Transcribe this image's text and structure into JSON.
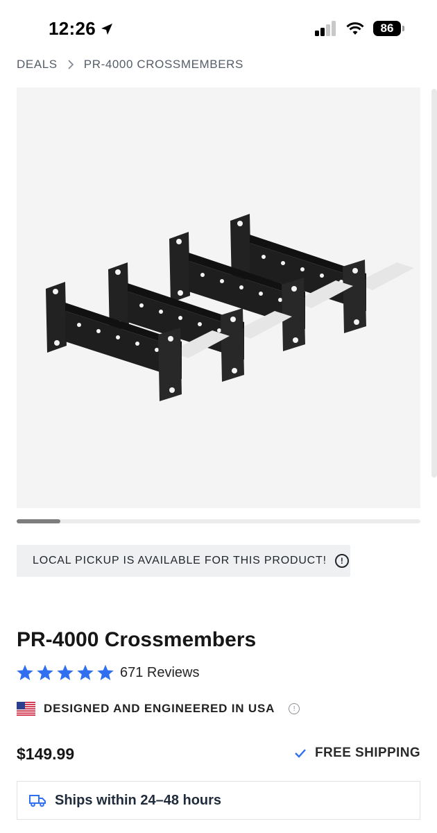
{
  "status_bar": {
    "time": "12:26",
    "battery": "86"
  },
  "breadcrumb": {
    "items": [
      "DEALS",
      "PR-4000 CROSSMEMBERS"
    ],
    "separator": ">"
  },
  "carousel": {
    "position": 1
  },
  "pickup_notice": {
    "text": "LOCAL PICKUP IS AVAILABLE FOR THIS PRODUCT!",
    "icon": "info-icon"
  },
  "product": {
    "title": "PR-4000 Crossmembers",
    "rating": 5,
    "reviews_label": "671 Reviews",
    "origin_label": "DESIGNED AND ENGINEERED IN USA",
    "price": "$149.99",
    "shipping_label": "FREE SHIPPING",
    "ships_within": "Ships within 24–48 hours"
  },
  "colors": {
    "star": "#2f6ff0",
    "check": "#2f6ff0",
    "truck": "#2f6ff0",
    "image_bg": "#f4f4f4"
  }
}
